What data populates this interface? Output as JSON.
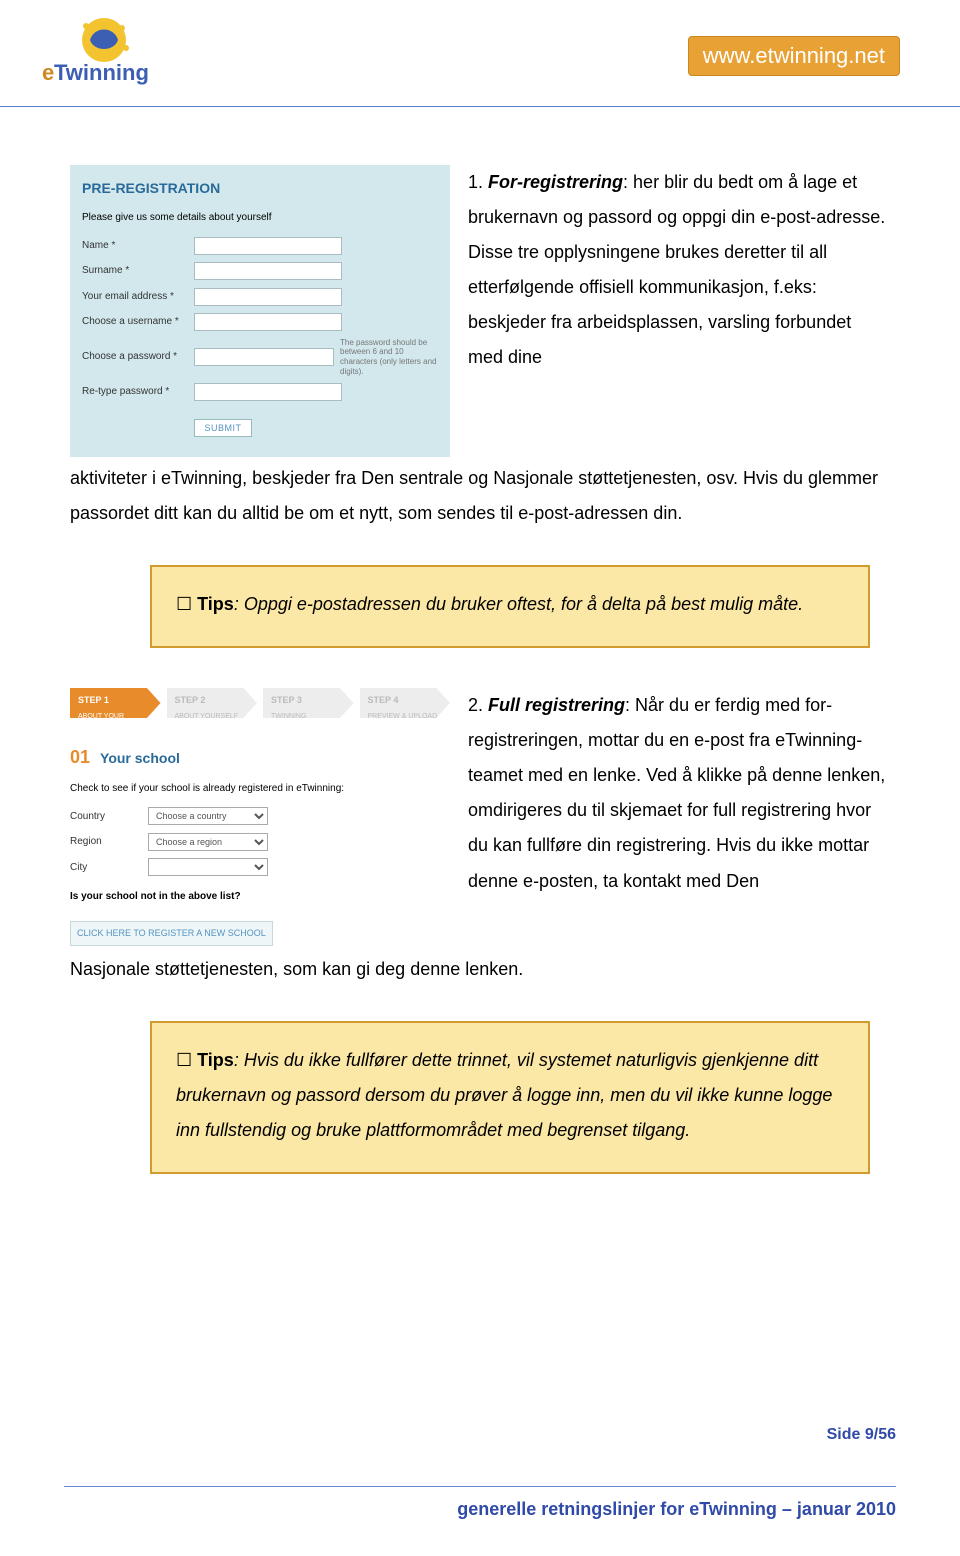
{
  "header": {
    "url": "www.etwinning.net"
  },
  "form": {
    "title": "PRE-REGISTRATION",
    "subtitle": "Please give us some details about yourself",
    "labels": {
      "name": "Name *",
      "surname": "Surname *",
      "email": "Your email address *",
      "username": "Choose a username *",
      "password": "Choose a password *",
      "retype": "Re-type password *"
    },
    "hint": "The password should be between 6 and 10 characters (only letters and digits).",
    "submit": "SUBMIT"
  },
  "para1": {
    "lead_num": "1. ",
    "lead_title": "For-registrering",
    "lead_rest": ": her blir du bedt om å lage et brukernavn og passord og oppgi din e-post-adresse. Disse tre opplysningene brukes deretter til all etterfølgende offisiell kommunikasjon, f.eks: beskjeder fra arbeidsplassen, varsling forbundet med dine",
    "cont": "aktiviteter i eTwinning, beskjeder fra Den sentrale og Nasjonale støttetjenesten, osv. Hvis du glemmer passordet ditt kan du alltid be om et nytt, som sendes til e-post-adressen din."
  },
  "tips1": {
    "tips": "Tips",
    "text": ": Oppgi e-postadressen du bruker oftest, for å delta på best mulig måte."
  },
  "steps": {
    "s1": {
      "t": "STEP 1",
      "s": "ABOUT YOUR SCHOOL"
    },
    "s2": {
      "t": "STEP 2",
      "s": "ABOUT YOURSELF"
    },
    "s3": {
      "t": "STEP 3",
      "s": "TWINNING PREFERENCES"
    },
    "s4": {
      "t": "STEP 4",
      "s": "PREVIEW & UPLOAD"
    }
  },
  "school": {
    "num": "01",
    "title": "Your school",
    "subtitle": "Check to see if your school is already registered in eTwinning:",
    "country_lbl": "Country",
    "region_lbl": "Region",
    "city_lbl": "City",
    "country_ph": "Choose a country",
    "region_ph": "Choose a region",
    "question": "Is your school not in the above list?",
    "link": "CLICK HERE TO REGISTER A NEW SCHOOL"
  },
  "para2": {
    "lead_num": "2. ",
    "lead_title": "Full registrering",
    "text": ": Når du er ferdig med for-registreringen, mottar du en e-post fra eTwinning-teamet med en lenke. Ved å klikke på denne lenken, omdirigeres du til skjemaet for full registrering hvor du kan fullføre din registrering. Hvis du ikke mottar denne e-posten, ta kontakt med Den",
    "cont": "Nasjonale støttetjenesten, som kan gi deg denne lenken."
  },
  "tips2": {
    "tips": "Tips",
    "text": ": Hvis du ikke fullfører dette trinnet, vil systemet naturligvis gjenkjenne ditt brukernavn og passord dersom du prøver å logge inn, men du vil ikke kunne logge inn fullstendig og bruke plattformområdet med begrenset tilgang."
  },
  "footer": {
    "page": "Side 9/56",
    "title": "generelle retningslinjer for eTwinning – januar 2010"
  }
}
